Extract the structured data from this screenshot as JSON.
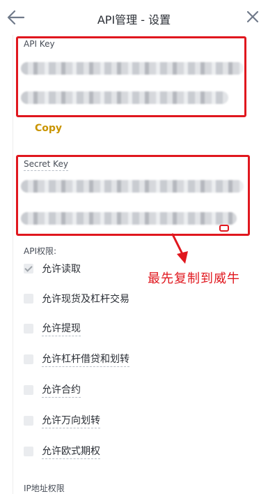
{
  "header": {
    "title": "API管理 - 设置",
    "back_icon": "arrow-left-icon",
    "close_icon": "close-icon"
  },
  "api_key": {
    "label": "API Key",
    "copy_label": "Copy"
  },
  "secret_key": {
    "label": "Secret Key"
  },
  "permissions": {
    "title": "API权限:",
    "items": [
      {
        "label": "允许读取",
        "checked": true
      },
      {
        "label": "允许现货及杠杆交易",
        "checked": false
      },
      {
        "label": "允许提现",
        "checked": false
      },
      {
        "label": "允许杠杆借贷和划转",
        "checked": false
      },
      {
        "label": "允许合约",
        "checked": false
      },
      {
        "label": "允许万向划转",
        "checked": false
      },
      {
        "label": "允许欧式期权",
        "checked": false
      }
    ]
  },
  "ip_section": {
    "title": "IP地址权限"
  },
  "annotation": {
    "text": "最先复制到威牛",
    "color": "#e0171e"
  },
  "colors": {
    "accent": "#c99400",
    "highlight": "#e0171e"
  }
}
